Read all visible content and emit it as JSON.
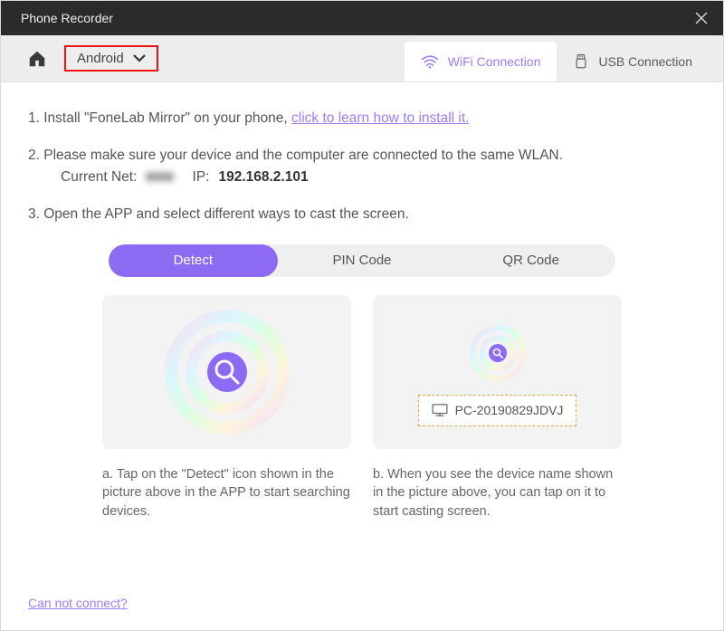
{
  "titlebar": {
    "title": "Phone Recorder"
  },
  "toolbar": {
    "platform_label": "Android",
    "wifi_tab": "WiFi Connection",
    "usb_tab": "USB Connection"
  },
  "steps": {
    "s1_prefix": "1. Install \"FoneLab Mirror\" on your phone, ",
    "s1_link": "click to learn how to install it.",
    "s2": "2. Please make sure your device and the computer are connected to the same WLAN.",
    "current_net_label": "Current Net:",
    "current_net_value": "■■■",
    "ip_label": "IP:",
    "ip_value": "192.168.2.101",
    "s3": "3. Open the APP and select different ways to cast the screen."
  },
  "cast_tabs": {
    "detect": "Detect",
    "pin": "PIN Code",
    "qr": "QR Code"
  },
  "device": {
    "name": "PC-20190829JDVJ"
  },
  "captions": {
    "a": "a. Tap on the \"Detect\" icon shown in the picture above in the APP to start searching devices.",
    "b": "b. When you see the device name shown in the picture above, you can tap on it to start casting screen."
  },
  "footer": {
    "cant_connect": "Can not connect?"
  }
}
